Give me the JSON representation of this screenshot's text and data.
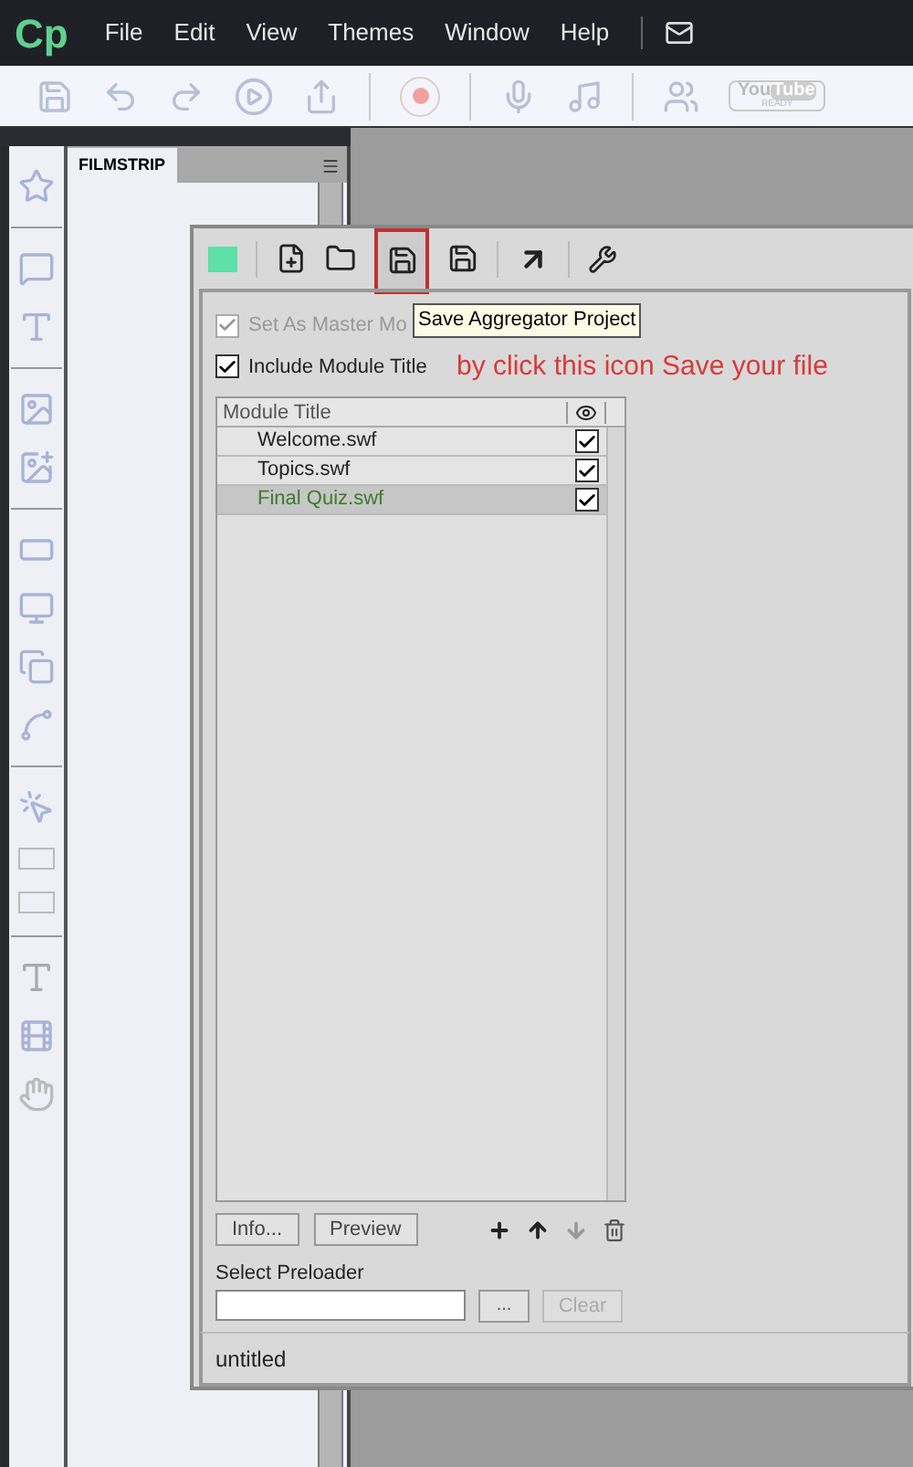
{
  "app": {
    "logo": "Cp",
    "menu": [
      "File",
      "Edit",
      "View",
      "Themes",
      "Window",
      "Help"
    ]
  },
  "toolbar": {
    "youtube_badge": {
      "left": "You",
      "right": "Tube",
      "caption": "READY"
    }
  },
  "panel": {
    "tab": "FILMSTRIP"
  },
  "dialog": {
    "tooltip": "Save Aggregator Project",
    "annotation": "by click this icon Save your file",
    "options": [
      {
        "label": "Set As Master Mo",
        "checked": true,
        "disabled": true
      },
      {
        "label": "Include Module Title",
        "checked": true,
        "disabled": false
      }
    ],
    "table": {
      "column": "Module Title",
      "rows": [
        {
          "title": "Welcome.swf",
          "selected": false,
          "checked": true
        },
        {
          "title": "Topics.swf",
          "selected": false,
          "checked": true
        },
        {
          "title": "Final Quiz.swf",
          "selected": true,
          "checked": true
        }
      ]
    },
    "buttons": [
      {
        "label": "Info...",
        "disabled": false
      },
      {
        "label": "Preview",
        "disabled": false
      }
    ],
    "preloader": {
      "label": "Select Preloader",
      "browse": {
        "label": "...",
        "disabled": false
      },
      "clear": {
        "label": "Clear",
        "disabled": true
      }
    },
    "status": "untitled"
  }
}
